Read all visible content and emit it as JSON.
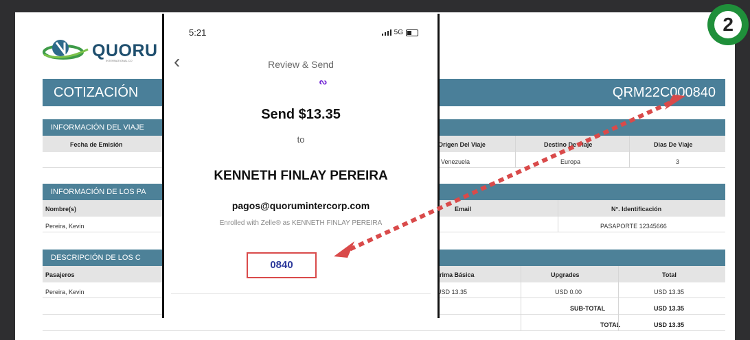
{
  "phone": {
    "time": "5:21",
    "network": "5G",
    "header_title": "Review & Send",
    "send_amount": "Send $13.35",
    "to_text": "to",
    "recipient_name": "KENNETH FINLAY PEREIRA",
    "recipient_email": "pagos@quorumintercorp.com",
    "enrolled_text": "Enrolled with Zelle® as KENNETH FINLAY PEREIRA",
    "memo": "0840"
  },
  "document": {
    "logo_text": "QUORU",
    "logo_subtext": "INTERNATIONAL CO",
    "title": "COTIZACIÓN",
    "quote_number": "QRM22C000840",
    "badge": "2",
    "section_travel": "INFORMACIÓN DEL VIAJE",
    "travel_headers": {
      "emission_date": "Fecha de Emisión",
      "origin": "Origen Del Viaje",
      "destination": "Destino De Viaje",
      "days": "Dias De Viaje"
    },
    "travel_row": {
      "origin": "Venezuela",
      "destination": "Europa",
      "days": "3"
    },
    "section_passengers": "INFORMACIÓN DE LOS PA",
    "passenger_headers": {
      "names": "Nombre(s)",
      "email": "Email",
      "id": "N°. Identificación"
    },
    "passenger_row": {
      "name": "Pereira, Kevin",
      "id": "PASAPORTE 12345666"
    },
    "section_description": "DESCRIPCIÓN DE LOS C",
    "desc_headers": {
      "passengers": "Pasajeros",
      "base": "Prima Básica",
      "upgrades": "Upgrades",
      "total": "Total"
    },
    "desc_row": {
      "name": "Pereira, Kevin",
      "base": "USD 13.35",
      "upgrades": "USD 0.00",
      "total": "USD 13.35"
    },
    "subtotal_label": "SUB-TOTAL",
    "subtotal_value": "USD 13.35",
    "total_label": "TOTAL",
    "total_value": "USD 13.35"
  },
  "colors": {
    "header_blue": "#4a7f99",
    "annotation_red": "#d94a4a",
    "zelle_purple": "#6d1ed4"
  }
}
